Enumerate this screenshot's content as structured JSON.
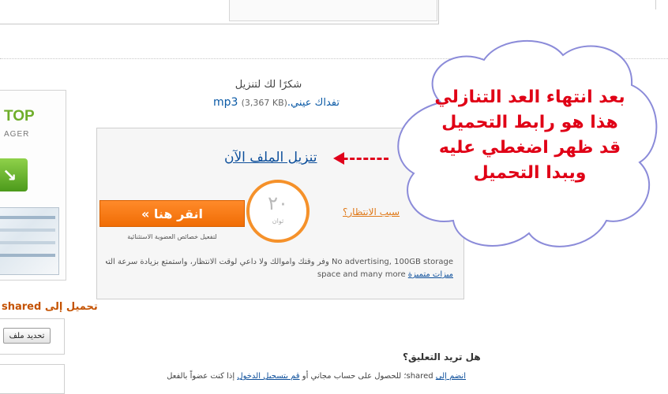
{
  "left_ad": {
    "title": "TOP",
    "subtitle": "AGER"
  },
  "left_panel": {
    "upload_label": "تحميل إلى shared",
    "update_button": "تحديد ملف"
  },
  "download": {
    "thanks": "شكرًا لك لتنزيل",
    "file_name": "تفداك عيني.",
    "file_size": "(3,367 KB)",
    "file_ext": "mp3",
    "download_link": "تنزيل الملف الآن",
    "click_button": "انقر هنا »",
    "premium_note": "لتفعيل خصائص العضوية الاستثنائية",
    "timer_value": "٢٠",
    "timer_unit": "ثوان",
    "why_wait": "سبب الانتظار؟",
    "text_line1": "No advertising, 100GB storage  وفر وقتك وأموالك ولا داعي لوقت الانتظار، واستمتع بزيادة سرعة التحميل/التنزيل.",
    "text_line2_plain": "space and many more",
    "text_line2_link": "ميزات متميزة"
  },
  "annotation": {
    "callout_text": "بعد انتهاء العد التنازلي هذا هو رابط التحميل قد ظهر اضغطي عليه ويبدا التحميل",
    "accent_color": "#e00016"
  },
  "comments": {
    "title": "هل تريد التعليق؟",
    "join_link": "انضم إلى",
    "join_tail": "shared",
    "middle_text": "؛ للحصول على حساب مجاني أو",
    "login_link": "قم بتسجيل الدخول",
    "end_text": "إذا كنت عضواً بالفعل"
  }
}
